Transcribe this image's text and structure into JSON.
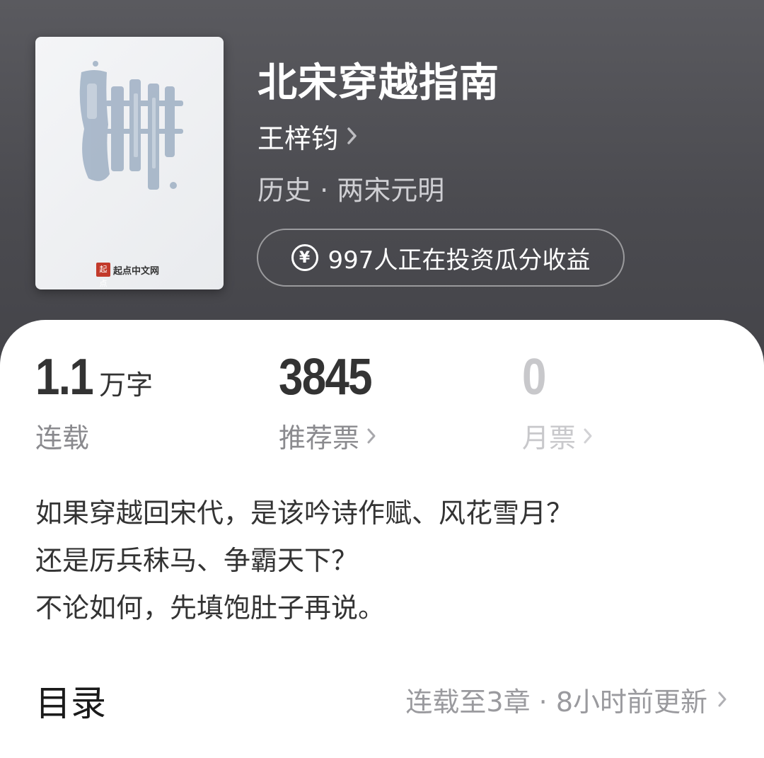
{
  "book": {
    "title": "北宋穿越指南",
    "author": "王梓钧",
    "genre": "历史 · 两宋元明",
    "investment": "997人正在投资瓜分收益",
    "cover_publisher": "起点中文网",
    "cover_seal": "起点"
  },
  "stats": {
    "words": {
      "value": "1.1",
      "unit": "万字",
      "label": "连载"
    },
    "recommend": {
      "value": "3845",
      "label": "推荐票"
    },
    "monthly": {
      "value": "0",
      "label": "月票"
    }
  },
  "description": [
    "如果穿越回宋代，是该吟诗作赋、风花雪月？",
    "还是厉兵秣马、争霸天下？",
    "不论如何，先填饱肚子再说。"
  ],
  "toc": {
    "title": "目录",
    "info": "连载至3章 · 8小时前更新"
  },
  "icons": {
    "author_chevron": "chevron-right-icon",
    "invest": "yen-coin-icon"
  },
  "colors": {
    "hero_bg": "#4b4b50",
    "text_primary": "#333333",
    "text_secondary": "#8a8a8e",
    "text_disabled": "#c8c8cb"
  }
}
